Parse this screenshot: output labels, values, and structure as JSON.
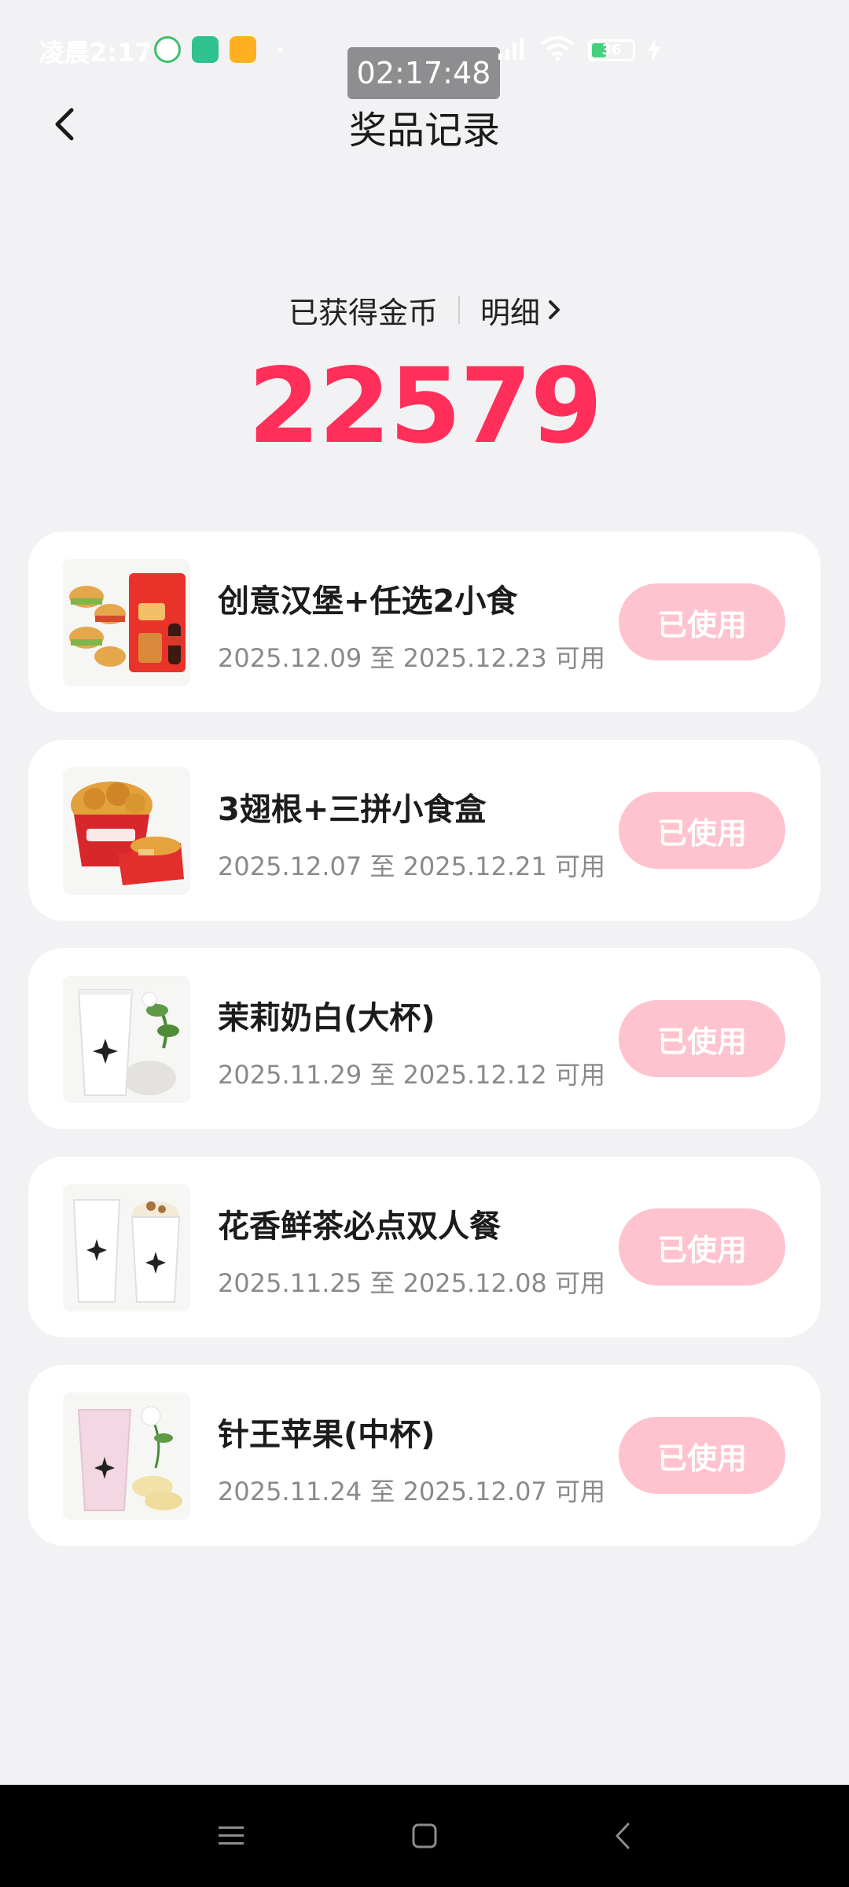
{
  "status_bar": {
    "time": "凌晨2:17",
    "timer": "02:17:48",
    "battery": "36",
    "battery_level": 0.36
  },
  "header": {
    "title": "奖品记录"
  },
  "coins": {
    "label": "已获得金币",
    "details_label": "明细",
    "value": "22579"
  },
  "records": [
    {
      "name": "创意汉堡+任选2小食",
      "validity": "2025.12.09 至 2025.12.23 可用",
      "button": "已使用",
      "thumbnail": "burger-combo-image"
    },
    {
      "name": "3翅根+三拼小食盒",
      "validity": "2025.12.07 至 2025.12.21 可用",
      "button": "已使用",
      "thumbnail": "fried-chicken-bucket-image"
    },
    {
      "name": "茉莉奶白(大杯)",
      "validity": "2025.11.29 至 2025.12.12 可用",
      "button": "已使用",
      "thumbnail": "jasmine-milk-tea-cup-image"
    },
    {
      "name": "花香鲜茶必点双人餐",
      "validity": "2025.11.25 至 2025.12.08 可用",
      "button": "已使用",
      "thumbnail": "two-tea-cups-image"
    },
    {
      "name": "针王苹果(中杯)",
      "validity": "2025.11.24 至 2025.12.07 可用",
      "button": "已使用",
      "thumbnail": "apple-tea-cup-image"
    }
  ],
  "colors": {
    "accent": "#ff2f5a",
    "button_bg": "#ffc2cf",
    "page_bg": "#f2f2f4"
  }
}
